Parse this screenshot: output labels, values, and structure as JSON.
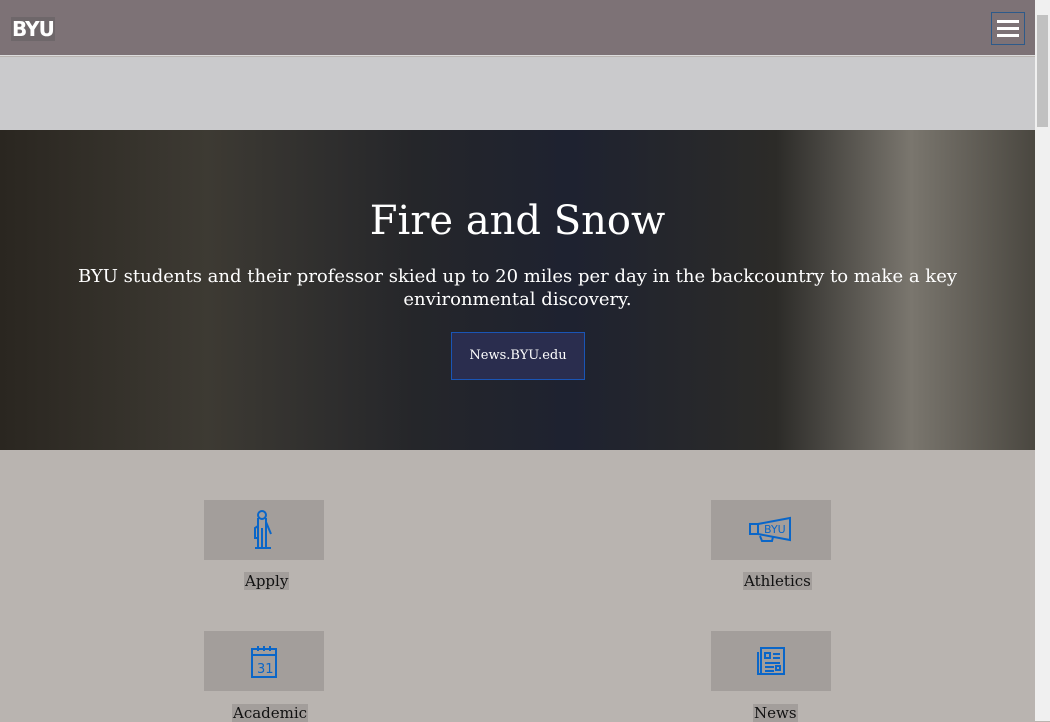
{
  "header": {
    "logo": "BYU"
  },
  "hero": {
    "title": "Fire and Snow",
    "subtitle": "BYU students and their professor skied up to 20 miles per day in the backcountry to make a key environmental discovery.",
    "button": "News.BYU.edu"
  },
  "tiles": [
    {
      "label": "Apply",
      "icon": "graduate-icon"
    },
    {
      "label": "Athletics",
      "icon": "megaphone-icon"
    },
    {
      "label": "Academic",
      "icon": "calendar-icon"
    },
    {
      "label": "News",
      "icon": "newspaper-icon"
    }
  ],
  "colors": {
    "header": "#7d7276",
    "icon": "#0a66c8",
    "button": "#2a2d4e"
  }
}
